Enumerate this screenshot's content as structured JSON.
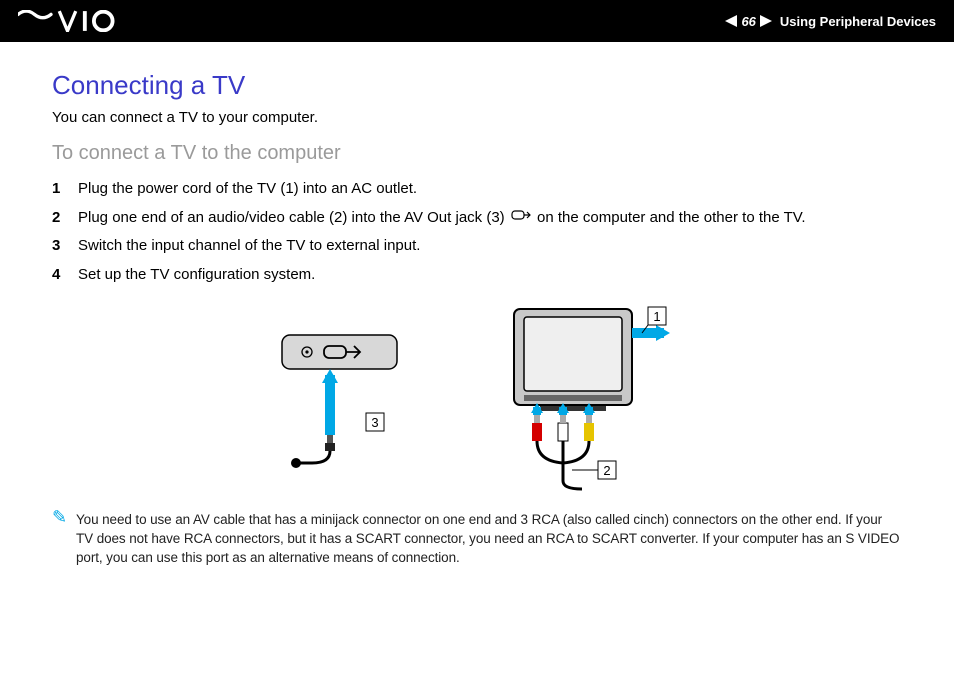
{
  "header": {
    "page_number": "66",
    "section": "Using Peripheral Devices"
  },
  "title": "Connecting a TV",
  "intro": "You can connect a TV to your computer.",
  "subtitle": "To connect a TV to the computer",
  "steps": [
    "Plug the power cord of the TV (1) into an AC outlet.",
    "Plug one end of an audio/video cable (2) into the AV Out jack (3)        on the computer and the other to the TV.",
    "Switch the input channel of the TV to external input.",
    "Set up the TV configuration system."
  ],
  "diagram": {
    "labels": {
      "one": "1",
      "two": "2",
      "three": "3"
    }
  },
  "note": "You need to use an AV cable that has a minijack connector on one end and 3 RCA (also called cinch) connectors on the other end. If your TV does not have RCA connectors, but it has a SCART connector, you need an RCA to SCART converter. If your computer has an S VIDEO port, you can use this port as an alternative means of connection."
}
